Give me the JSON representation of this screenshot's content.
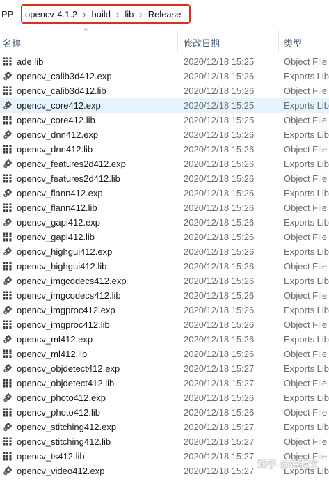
{
  "breadcrumb": {
    "truncated_prefix": "PP",
    "segments": [
      "opencv-4.1.2",
      "build",
      "lib",
      "Release"
    ],
    "separator": "›",
    "highlight_color": "#d9301e"
  },
  "columns": {
    "name": "名称",
    "date": "修改日期",
    "type": "类型"
  },
  "sort_indicator": "^",
  "files": [
    {
      "name": "ade.lib",
      "date": "2020/12/18 15:25",
      "type": "Object File",
      "icon": "lib-icon"
    },
    {
      "name": "opencv_calib3d412.exp",
      "date": "2020/12/18 15:26",
      "type": "Exports Lib",
      "icon": "exp-icon"
    },
    {
      "name": "opencv_calib3d412.lib",
      "date": "2020/12/18 15:26",
      "type": "Object File",
      "icon": "lib-icon"
    },
    {
      "name": "opencv_core412.exp",
      "date": "2020/12/18 15:25",
      "type": "Exports Lib",
      "icon": "exp-icon",
      "selected": true
    },
    {
      "name": "opencv_core412.lib",
      "date": "2020/12/18 15:25",
      "type": "Object File",
      "icon": "lib-icon"
    },
    {
      "name": "opencv_dnn412.exp",
      "date": "2020/12/18 15:26",
      "type": "Exports Lib",
      "icon": "exp-icon"
    },
    {
      "name": "opencv_dnn412.lib",
      "date": "2020/12/18 15:26",
      "type": "Object File",
      "icon": "lib-icon"
    },
    {
      "name": "opencv_features2d412.exp",
      "date": "2020/12/18 15:26",
      "type": "Exports Lib",
      "icon": "exp-icon"
    },
    {
      "name": "opencv_features2d412.lib",
      "date": "2020/12/18 15:26",
      "type": "Object File",
      "icon": "lib-icon"
    },
    {
      "name": "opencv_flann412.exp",
      "date": "2020/12/18 15:26",
      "type": "Exports Lib",
      "icon": "exp-icon"
    },
    {
      "name": "opencv_flann412.lib",
      "date": "2020/12/18 15:26",
      "type": "Object File",
      "icon": "lib-icon"
    },
    {
      "name": "opencv_gapi412.exp",
      "date": "2020/12/18 15:26",
      "type": "Exports Lib",
      "icon": "exp-icon"
    },
    {
      "name": "opencv_gapi412.lib",
      "date": "2020/12/18 15:26",
      "type": "Object File",
      "icon": "lib-icon"
    },
    {
      "name": "opencv_highgui412.exp",
      "date": "2020/12/18 15:26",
      "type": "Exports Lib",
      "icon": "exp-icon"
    },
    {
      "name": "opencv_highgui412.lib",
      "date": "2020/12/18 15:26",
      "type": "Object File",
      "icon": "lib-icon"
    },
    {
      "name": "opencv_imgcodecs412.exp",
      "date": "2020/12/18 15:26",
      "type": "Exports Lib",
      "icon": "exp-icon"
    },
    {
      "name": "opencv_imgcodecs412.lib",
      "date": "2020/12/18 15:26",
      "type": "Object File",
      "icon": "lib-icon"
    },
    {
      "name": "opencv_imgproc412.exp",
      "date": "2020/12/18 15:26",
      "type": "Exports Lib",
      "icon": "exp-icon"
    },
    {
      "name": "opencv_imgproc412.lib",
      "date": "2020/12/18 15:26",
      "type": "Object File",
      "icon": "lib-icon"
    },
    {
      "name": "opencv_ml412.exp",
      "date": "2020/12/18 15:26",
      "type": "Exports Lib",
      "icon": "exp-icon"
    },
    {
      "name": "opencv_ml412.lib",
      "date": "2020/12/18 15:26",
      "type": "Object File",
      "icon": "lib-icon"
    },
    {
      "name": "opencv_objdetect412.exp",
      "date": "2020/12/18 15:27",
      "type": "Exports Lib",
      "icon": "exp-icon"
    },
    {
      "name": "opencv_objdetect412.lib",
      "date": "2020/12/18 15:27",
      "type": "Object File",
      "icon": "lib-icon"
    },
    {
      "name": "opencv_photo412.exp",
      "date": "2020/12/18 15:26",
      "type": "Exports Lib",
      "icon": "exp-icon"
    },
    {
      "name": "opencv_photo412.lib",
      "date": "2020/12/18 15:26",
      "type": "Object File",
      "icon": "lib-icon"
    },
    {
      "name": "opencv_stitching412.exp",
      "date": "2020/12/18 15:27",
      "type": "Exports Lib",
      "icon": "exp-icon"
    },
    {
      "name": "opencv_stitching412.lib",
      "date": "2020/12/18 15:27",
      "type": "Object File",
      "icon": "lib-icon"
    },
    {
      "name": "opencv_ts412.lib",
      "date": "2020/12/18 15:27",
      "type": "Object File",
      "icon": "lib-icon"
    },
    {
      "name": "opencv_video412.exp",
      "date": "2020/12/18 15:27",
      "type": "Exports Lib",
      "icon": "exp-icon"
    }
  ],
  "watermark": "知乎 @韩腾文"
}
